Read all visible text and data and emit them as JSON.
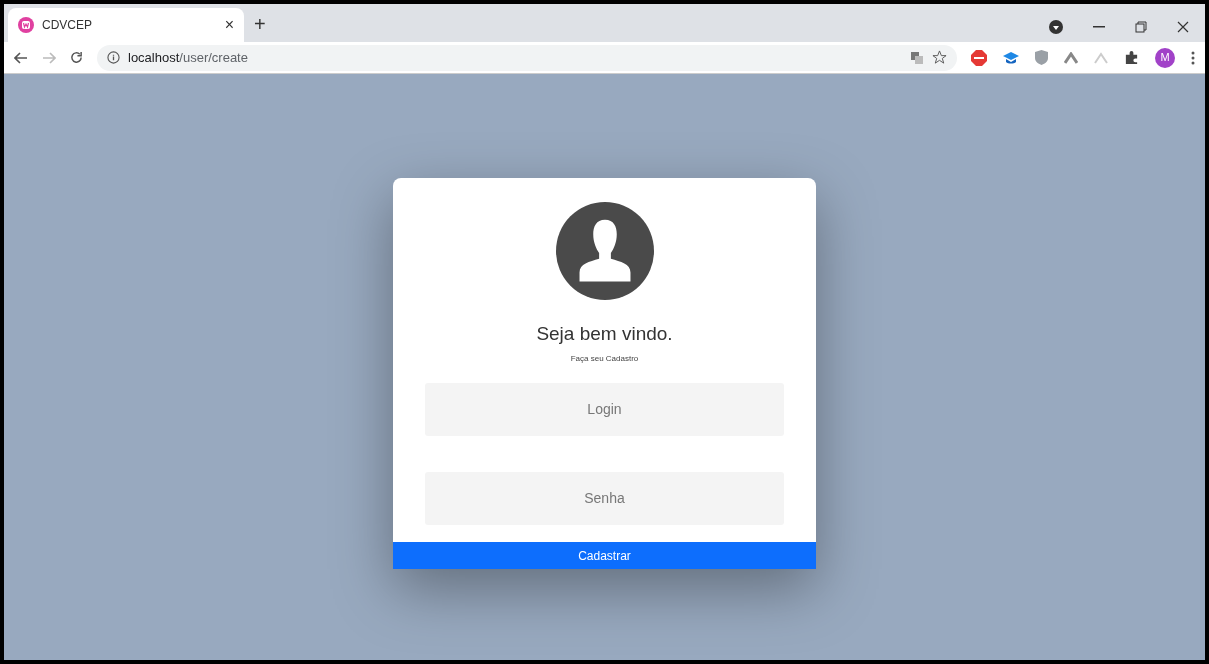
{
  "browser": {
    "tabs": [
      {
        "title": "CDVCEP",
        "close": "×",
        "selected": true
      }
    ],
    "new_tab": "+",
    "url_host": "localhost",
    "url_path": "/user/create",
    "profile_initial": "M"
  },
  "card": {
    "title": "Seja bem vindo.",
    "subtitle": "Faça seu Cadastro",
    "fields": [
      {
        "placeholder": "Login"
      },
      {
        "placeholder": "Senha"
      }
    ],
    "button": "Cadastrar"
  }
}
